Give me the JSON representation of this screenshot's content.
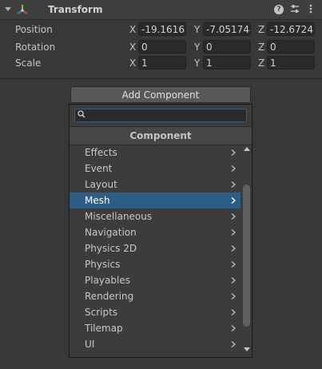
{
  "header": {
    "title": "Transform"
  },
  "transform": {
    "rows": [
      {
        "label": "Position",
        "x": "-19.16165",
        "y": "-7.051744",
        "z": "-12.67242"
      },
      {
        "label": "Rotation",
        "x": "0",
        "y": "0",
        "z": "0"
      },
      {
        "label": "Scale",
        "x": "1",
        "y": "1",
        "z": "1"
      }
    ],
    "axis_labels": {
      "x": "X",
      "y": "Y",
      "z": "Z"
    }
  },
  "add_component": {
    "button_label": "Add Component",
    "search_value": "",
    "category_title": "Component",
    "items": [
      {
        "label": "Effects"
      },
      {
        "label": "Event"
      },
      {
        "label": "Layout"
      },
      {
        "label": "Mesh",
        "selected": true
      },
      {
        "label": "Miscellaneous"
      },
      {
        "label": "Navigation"
      },
      {
        "label": "Physics 2D"
      },
      {
        "label": "Physics"
      },
      {
        "label": "Playables"
      },
      {
        "label": "Rendering"
      },
      {
        "label": "Scripts"
      },
      {
        "label": "Tilemap"
      },
      {
        "label": "UI"
      }
    ]
  },
  "colors": {
    "background": "#383838",
    "selection": "#2c5d87",
    "field": "#2a2a2a"
  }
}
